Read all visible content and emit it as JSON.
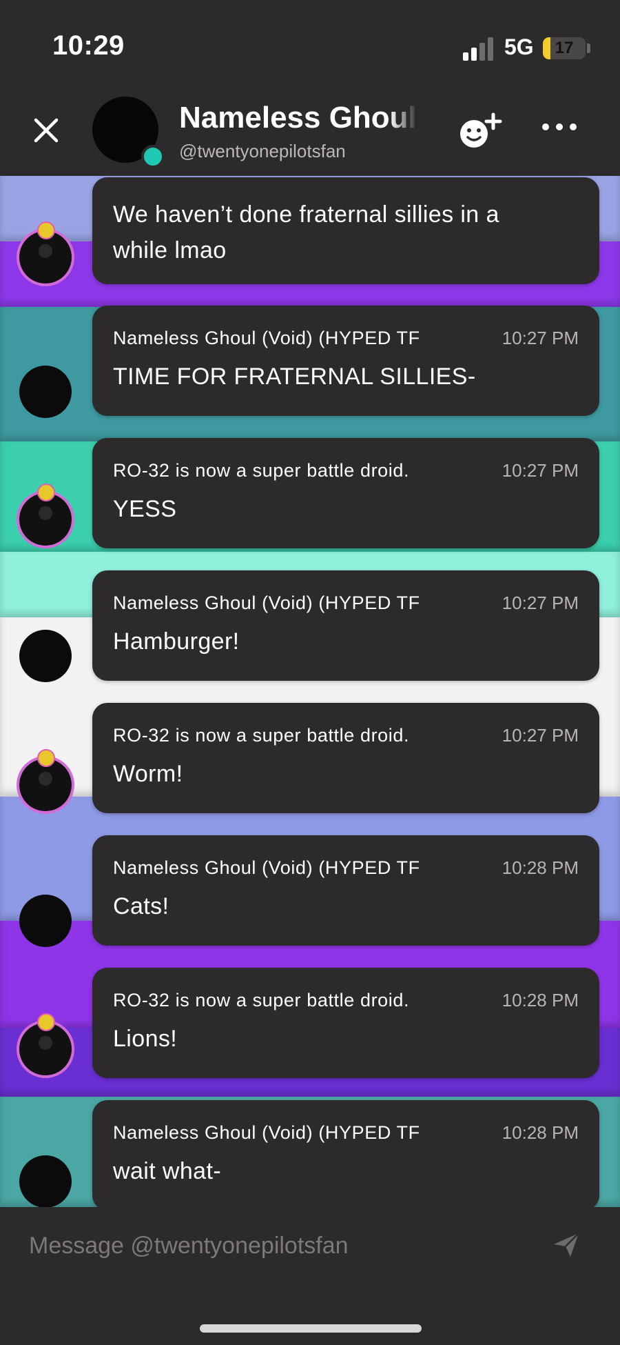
{
  "status_bar": {
    "time": "10:29",
    "network": "5G",
    "battery": "17",
    "battery_level": 0.17
  },
  "header": {
    "name": "Nameless Ghoul",
    "handle": "@twentyonepilotsfan",
    "close_icon": "close-icon",
    "add_friend_icon": "add-friend-icon",
    "more_icon": "more-icon"
  },
  "colors": {
    "wallpaper": [
      "#9aa4e4",
      "#8d38e8",
      "#3e9aa0",
      "#3ccfae",
      "#8ff0dc",
      "#f2f2f3",
      "#8e9ae6",
      "#8f35e8",
      "#6a2fd2",
      "#4ba7a4"
    ],
    "bubble": "#2d2a2b",
    "online": "#1ec8b3",
    "ring": "#d36bd6"
  },
  "messages": [
    {
      "sender": "",
      "time": "",
      "text": "We haven’t done fraternal sillies in a while lmao",
      "avatar": "ring"
    },
    {
      "sender": "Nameless Ghoul (Void) (HYPED TF",
      "time": "10:27 PM",
      "text": "TIME FOR FRATERNAL SILLIES-",
      "avatar": "plain"
    },
    {
      "sender": "RO-32 is now a super battle droid.",
      "time": "10:27 PM",
      "text": "YESS",
      "avatar": "ring"
    },
    {
      "sender": "Nameless Ghoul (Void) (HYPED TF",
      "time": "10:27 PM",
      "text": "Hamburger!",
      "avatar": "plain"
    },
    {
      "sender": "RO-32 is now a super battle droid.",
      "time": "10:27 PM",
      "text": "Worm!",
      "avatar": "ring"
    },
    {
      "sender": "Nameless Ghoul (Void) (HYPED TF",
      "time": "10:28 PM",
      "text": "Cats!",
      "avatar": "plain"
    },
    {
      "sender": "RO-32 is now a super battle droid.",
      "time": "10:28 PM",
      "text": "Lions!",
      "avatar": "ring"
    },
    {
      "sender": "Nameless Ghoul (Void) (HYPED TF",
      "time": "10:28 PM",
      "text": "wait what-",
      "avatar": "plain"
    }
  ],
  "composer": {
    "placeholder": "Message @twentyonepilotsfan",
    "send_icon": "send-icon"
  }
}
